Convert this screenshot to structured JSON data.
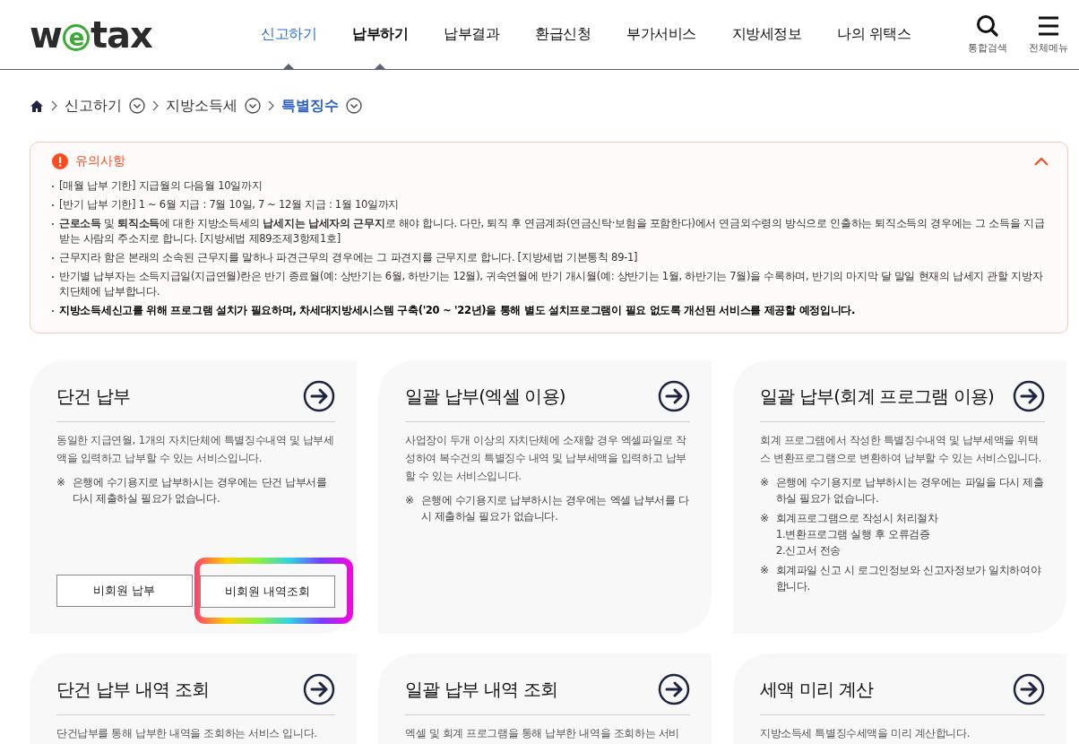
{
  "header": {
    "logo_parts": [
      {
        "text": "w",
        "kind": "plain"
      },
      {
        "text": "e",
        "kind": "ringed"
      },
      {
        "text": "tax",
        "kind": "plain"
      }
    ],
    "nav": [
      {
        "label": "신고하기",
        "selected": true,
        "hovered": false
      },
      {
        "label": "납부하기",
        "selected": false,
        "hovered": true
      },
      {
        "label": "납부결과",
        "selected": false,
        "hovered": false
      },
      {
        "label": "환급신청",
        "selected": false,
        "hovered": false
      },
      {
        "label": "부가서비스",
        "selected": false,
        "hovered": false
      },
      {
        "label": "지방세정보",
        "selected": false,
        "hovered": false
      },
      {
        "label": "나의 위택스",
        "selected": false,
        "hovered": false
      }
    ],
    "tools": [
      {
        "kind": "search",
        "label": "통합검색"
      },
      {
        "kind": "menu",
        "label": "전체메뉴"
      }
    ]
  },
  "breadcrumb": [
    {
      "label": "신고하기",
      "current": false
    },
    {
      "label": "지방소득세",
      "current": false
    },
    {
      "label": "특별징수",
      "current": true
    }
  ],
  "notice": {
    "title": "유의사항",
    "expanded": true,
    "items": [
      {
        "text": "[매월 납부 기한] 지급월의 다음월 10일까지",
        "bold": false
      },
      {
        "text": "[반기 납부 기한] 1 ~ 6월 지급 : 7월 10일, 7 ~ 12월 지급 : 1월 10일까지",
        "bold": false
      },
      {
        "text": "**근로소득** 및 **퇴직소득**에 대한 지방소득세의 **납세지는 납세자의 근무지**로 해야 합니다. 다만, 퇴직 후 연금계좌(연금신탁·보험을 포함한다)에서 연금외수령의 방식으로 인출하는 퇴직소득의 경우에는 그 소득을 지급받는 사람의 주소지로 합니다. [지방세법 제89조제3항제1호]",
        "bold": false
      },
      {
        "text": "근무지라 함은 본래의 소속된 근무지를 말하나 파견근무의 경우에는 그 파견지를 근무지로 합니다. [지방세법 기본통칙 89-1]",
        "bold": false
      },
      {
        "text": "반기별 납부자는 소득지급일(지급연월)란은 반기 종료월(예: 상반기는 6월, 하반기는 12월), 귀속연월에 반기 개시월(예: 상반기는 1월, 하반기는 7월)을 수록하며, 반기의 마지막 달 말일 현재의 납세지 관할 지방자치단체에 납부합니다.",
        "bold": false
      },
      {
        "text": "**지방소득세신고를 위해 프로그램 설치가 필요하며, 차세대지방세시스템 구축('20 ~ '22년)을 통해 별도 설치프로그램이 필요 없도록 개선된 서비스를 제공할 예정입니다.**",
        "bold": true
      }
    ]
  },
  "cards": [
    {
      "title": "단건 납부",
      "description": "동일한 지급연월, 1개의 자치단체에 특별징수내역 및 납부세액을 입력하고 납부할 수 있는 서비스입니다.",
      "notes": [
        {
          "mark": "※",
          "lines": [
            "은행에 수기용지로 납부하시는 경우에는 단건 납부서를 다시 제출하실 필요가 없습니다."
          ]
        }
      ],
      "buttons": [
        {
          "label": "비회원 납부",
          "highlighted": false
        },
        {
          "label": "비회원 내역조회",
          "highlighted": true
        }
      ]
    },
    {
      "title": "일괄 납부(엑셀 이용)",
      "description": "사업장이 두개 이상의 자치단체에 소재할 경우 엑셀파일로 작성하여 복수건의 특별징수 내역 및 납부세액을 입력하고 납부할 수 있는 서비스입니다.",
      "notes": [
        {
          "mark": "※",
          "lines": [
            "은행에 수기용지로 납부하시는 경우에는 엑셀 납부서를 다시 제출하실 필요가 없습니다."
          ]
        }
      ]
    },
    {
      "title": "일괄 납부(회계 프로그램 이용)",
      "description": "회계 프로그램에서 작성한 특별징수내역 및 납부세액을 위택스 변환프로그램으로 변환하여 납부할 수 있는 서비스입니다.",
      "notes": [
        {
          "mark": "※",
          "lines": [
            "은행에 수기용지로 납부하시는 경우에는 파일을 다시 제출하실 필요가 없습니다."
          ]
        },
        {
          "mark": "※",
          "lines": [
            "회계프로그램으로 작성시 처리절차",
            "1.변환프로그램 실행 후 오류검증",
            "2.신고서 전송"
          ]
        },
        {
          "mark": "※",
          "lines": [
            "회계파일 신고 시 로그인정보와 신고자정보가 일치하여야 합니다."
          ]
        }
      ]
    },
    {
      "title": "단건 납부 내역 조회",
      "description": "단건납부를 통해 납부한 내역을 조회하는 서비스 입니다."
    },
    {
      "title": "일괄 납부 내역 조회",
      "description": "엑셀 및 회계 프로그램을 통해 납부한 내역을 조회하는 서비"
    },
    {
      "title": "세액 미리 계산",
      "description": "지방소득세 특별징수세액을 미리 계산합니다."
    }
  ]
}
